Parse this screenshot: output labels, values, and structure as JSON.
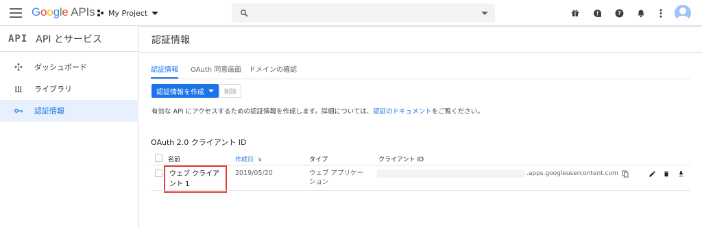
{
  "topbar": {
    "brand": {
      "google": "Google",
      "apis": "APIs"
    },
    "project": "My Project",
    "search": {
      "placeholder": ""
    },
    "icons": [
      "gift-icon",
      "notification-bubble-icon",
      "help-icon",
      "bell-icon",
      "more-vert-icon"
    ],
    "account": "avatar"
  },
  "sidebar": {
    "logo": "API",
    "title": "API とサービス",
    "items": [
      {
        "label": "ダッシュボード",
        "icon": "dashboard-icon",
        "active": false
      },
      {
        "label": "ライブラリ",
        "icon": "library-icon",
        "active": false
      },
      {
        "label": "認証情報",
        "icon": "key-icon",
        "active": true
      }
    ]
  },
  "main": {
    "title": "認証情報",
    "tabs": [
      {
        "label": "認証情報",
        "active": true
      },
      {
        "label": "OAuth 同意画面",
        "active": false
      },
      {
        "label": "ドメインの確認",
        "active": false
      }
    ],
    "create_button": "認証情報を作成",
    "delete_button": "削除",
    "description": {
      "text": "有効な API にアクセスするための認証情報を作成します。詳細については、",
      "link": "認証のドキュメント",
      "suffix": "をご覧ください。"
    },
    "section_title": "OAuth 2.0 クライアント ID",
    "table": {
      "headers": {
        "name": "名前",
        "created": "作成日",
        "type": "タイプ",
        "client_id": "クライアント ID"
      },
      "sort_indicator": "∨",
      "rows": [
        {
          "name": "ウェブ クライアント 1",
          "created": "2019/05/20",
          "type": "ウェブ アプリケーション",
          "client_id_suffix": ".apps.googleusercontent.com"
        }
      ]
    }
  },
  "colors": {
    "accent": "#1a73e8",
    "highlight": "#e53935",
    "active_bg": "#e8f0fe"
  }
}
